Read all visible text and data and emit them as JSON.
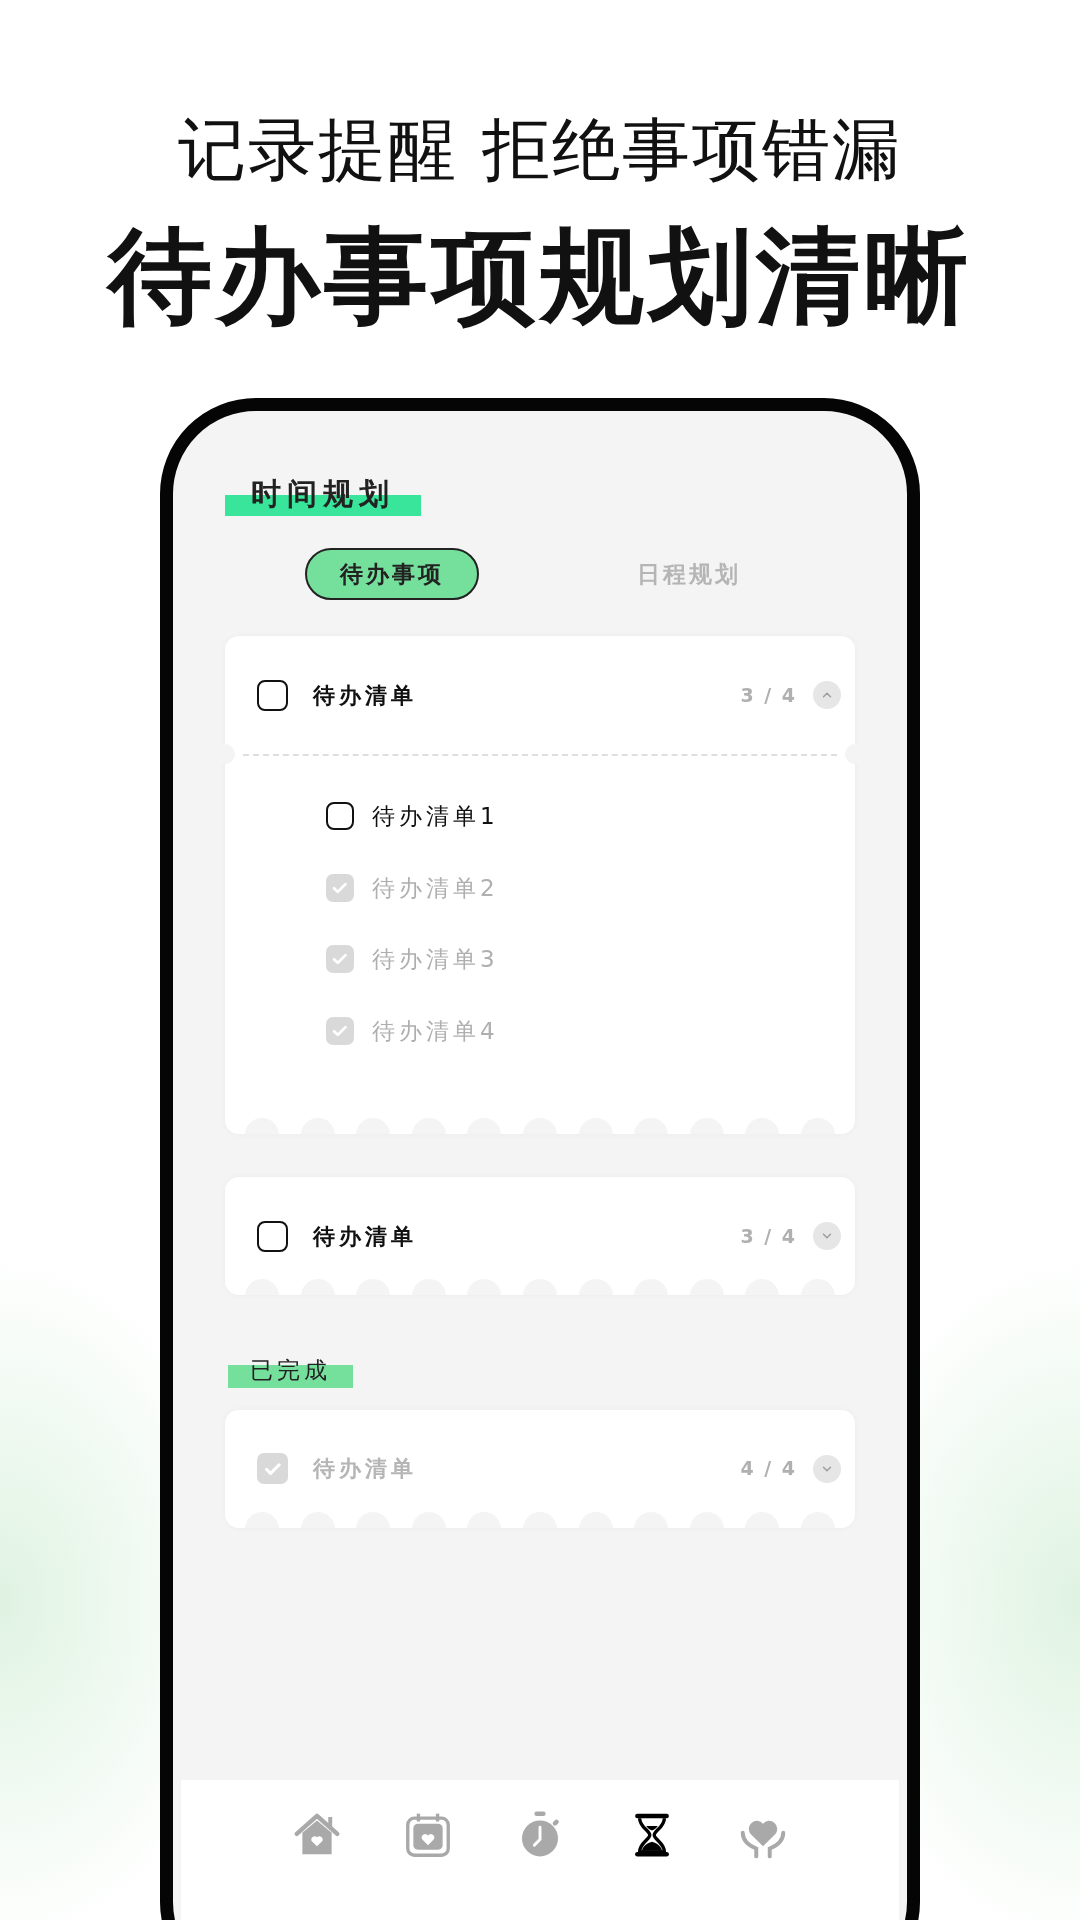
{
  "headline": {
    "subtitle": "记录提醒 拒绝事项错漏",
    "title": "待办事项规划清晰"
  },
  "screen": {
    "section_title": "时间规划",
    "tabs": [
      {
        "label": "待办事项",
        "selected": true
      },
      {
        "label": "日程规划",
        "selected": false
      }
    ],
    "lists": [
      {
        "title": "待办清单",
        "checked": false,
        "count": "3 / 4",
        "expanded": true,
        "items": [
          {
            "label": "待办清单1",
            "checked": false
          },
          {
            "label": "待办清单2",
            "checked": true
          },
          {
            "label": "待办清单3",
            "checked": true
          },
          {
            "label": "待办清单4",
            "checked": true
          }
        ]
      },
      {
        "title": "待办清单",
        "checked": false,
        "count": "3 / 4",
        "expanded": false
      }
    ],
    "completed_title": "已完成",
    "completed_lists": [
      {
        "title": "待办清单",
        "checked": true,
        "count": "4 / 4",
        "expanded": false
      }
    ],
    "nav": [
      {
        "kind": "home",
        "selected": false
      },
      {
        "kind": "calendar",
        "selected": false
      },
      {
        "kind": "stopwatch",
        "selected": false
      },
      {
        "kind": "hourglass",
        "selected": true
      },
      {
        "kind": "care",
        "selected": false
      }
    ]
  }
}
